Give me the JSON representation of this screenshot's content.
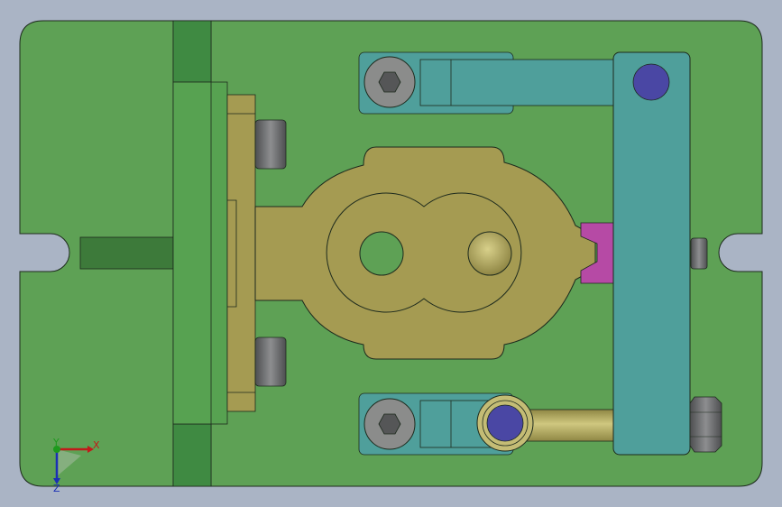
{
  "colors": {
    "background": "#aab4c5",
    "base_plate": "#5ea155",
    "base_plate_dark": "#3d7a3a",
    "rail": "#57a251",
    "rail_end": "#3f8a42",
    "bronze": "#a59b52",
    "bronze_light": "#c4bc75",
    "teal": "#4f9f9b",
    "teal_dark": "#3c807c",
    "bolt": "#8b8c8b",
    "bolt_dark": "#555657",
    "purple_pin": "#4a47a4",
    "magenta_block": "#b64aa5",
    "outline": "#1d2a1d"
  },
  "axes": {
    "x_label": "X",
    "y_label": "Y",
    "z_label": "Z",
    "x_color": "#c11a1a",
    "y_color": "#1d9a1d",
    "z_color": "#1a2fb5"
  }
}
